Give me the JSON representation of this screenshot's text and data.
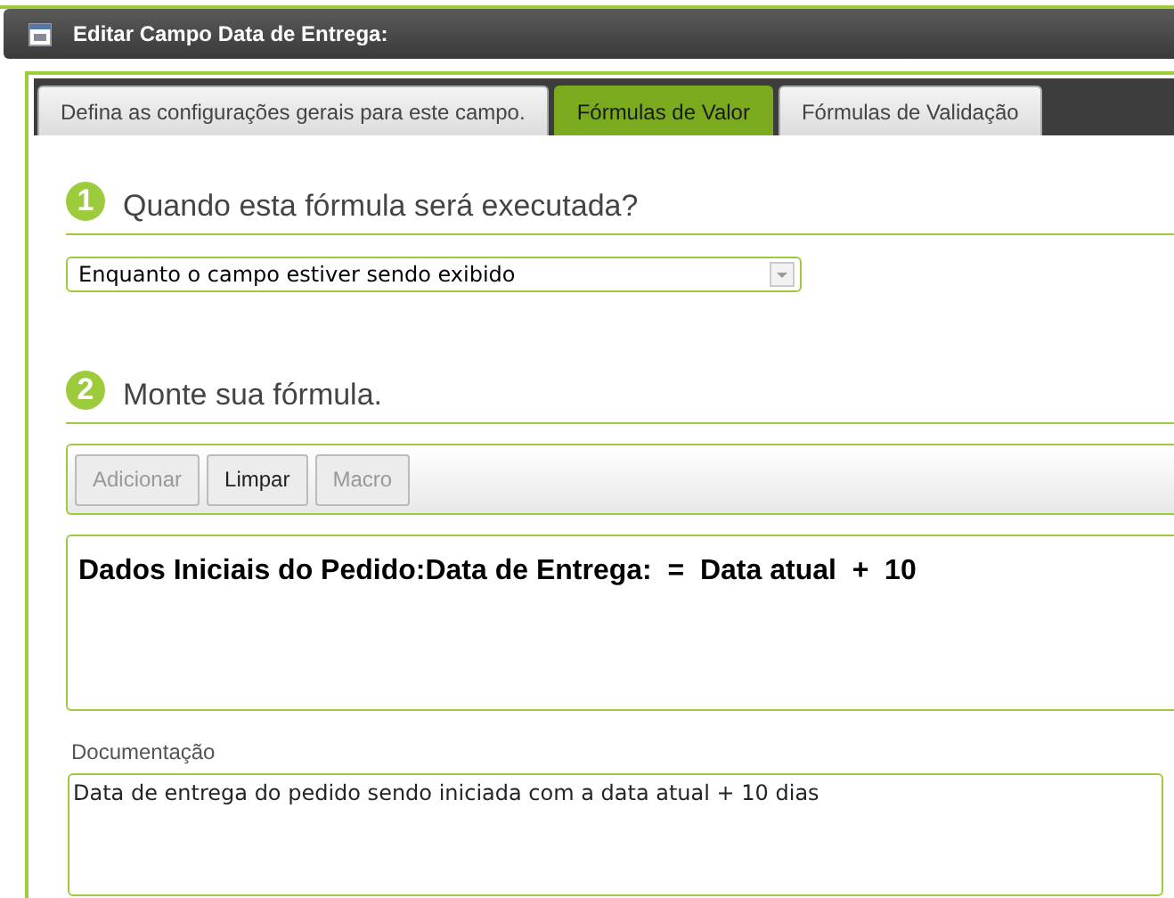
{
  "window": {
    "title": "Editar Campo Data de Entrega:"
  },
  "tabs": [
    {
      "label": "Defina as configurações gerais para este campo.",
      "selected": false
    },
    {
      "label": "Fórmulas de Valor",
      "selected": true
    },
    {
      "label": "Fórmulas de Validação",
      "selected": false
    }
  ],
  "steps": [
    {
      "number": "1",
      "title": "Quando esta fórmula será executada?"
    },
    {
      "number": "2",
      "title": "Monte sua fórmula."
    }
  ],
  "trigger_select": {
    "value": "Enquanto o campo estiver sendo exibido"
  },
  "toolbar": [
    {
      "label": "Adicionar",
      "disabled": true
    },
    {
      "label": "Limpar",
      "disabled": false
    },
    {
      "label": "Macro",
      "disabled": true
    }
  ],
  "formula": "Dados Iniciais do Pedido:Data de Entrega:  =  Data atual  +  10",
  "documentation": {
    "label": "Documentação",
    "value": "Data de entrega do pedido sendo iniciada com a data atual + 10 dias"
  }
}
